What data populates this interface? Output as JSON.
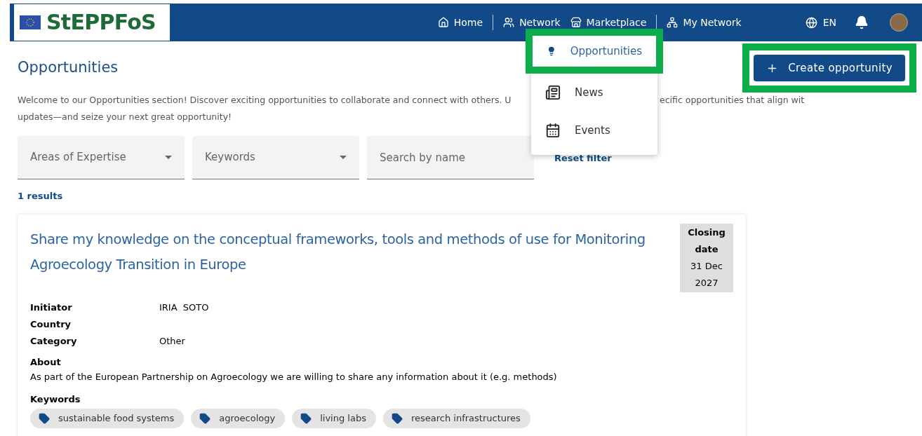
{
  "header": {
    "logo": "StEPPFoS",
    "nav": [
      {
        "label": "Home"
      },
      {
        "label": "Network"
      },
      {
        "label": "Marketplace"
      },
      {
        "label": "My Network"
      }
    ],
    "language": "EN"
  },
  "menu": {
    "items": [
      {
        "label": "Opportunities",
        "selected": true
      },
      {
        "label": "News",
        "selected": false
      },
      {
        "label": "Events",
        "selected": false
      }
    ]
  },
  "page": {
    "title": "Opportunities",
    "create_button": "Create opportunity",
    "intro_line1_left": "Welcome to our Opportunities section! Discover exciting opportunities to collaborate and connect with others. U",
    "intro_line1_right": "ecific opportunities that align wit",
    "intro_line2": "updates—and seize your next great opportunity!"
  },
  "filters": {
    "areas": {
      "placeholder": "Areas of Expertise"
    },
    "keywords": {
      "placeholder": "Keywords"
    },
    "search": {
      "placeholder": "Search by name"
    },
    "reset": "Reset filter"
  },
  "results_count": "1 results",
  "card": {
    "title": "Share my knowledge on the conceptual frameworks, tools and methods of use for Monitoring Agroecology Transition in Europe",
    "closing_label": "Closing date",
    "closing_date": "31 Dec 2027",
    "fields": [
      {
        "label": "Initiator",
        "value": "IRIA  SOTO"
      },
      {
        "label": "Country"
      },
      {
        "label": "Category",
        "value": "Other"
      }
    ],
    "about_label": "About",
    "about": "As part of the European Partnership on Agroecology we are willing to share any information about it (e.g. methods)",
    "keywords_label": "Keywords",
    "keywords": [
      "sustainable food systems",
      "agroecology",
      "living labs",
      "research infrastructures"
    ]
  }
}
